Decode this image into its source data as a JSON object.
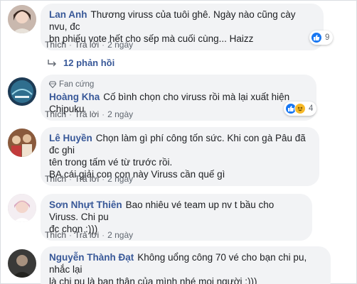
{
  "comments": [
    {
      "author": "Lan Anh",
      "lines": [
        "Thương viruss của tuôi ghê. Ngày nào cũng cày nvu, đc",
        "bn phiếu vote hết cho sếp mà cuối cùng... Haizz"
      ],
      "like_label": "Thích",
      "reply_label": "Trả lời",
      "time": "2 ngày",
      "reaction_count": "9",
      "replies_label": "12 phản hồi"
    },
    {
      "badge": "Fan cứng",
      "author": "Hoàng Kha",
      "lines": [
        "Cố bình chọn cho viruss rồi mà lại xuất hiện Chipuku"
      ],
      "like_label": "Thích",
      "reply_label": "Trả lời",
      "time": "2 ngày",
      "reaction_count": "4"
    },
    {
      "author": "Lê Huyền",
      "lines": [
        "Chọn làm gì phí công tốn sức. Khi con gà Pâu đã đc ghi",
        "tên trong tấm vé từ trước rồi.",
        "BA cái giải con con này Viruss cần quế gì"
      ],
      "like_label": "Thích",
      "reply_label": "Trả lời",
      "time": "2 ngày"
    },
    {
      "author": "Sơn Nhựt Thiên",
      "lines": [
        "Bao nhiêu vé team up nv t bầu cho Viruss. Chi pu",
        "đc chọn :)))"
      ],
      "like_label": "Thích",
      "reply_label": "Trả lời",
      "time": "2 ngày"
    },
    {
      "author": "Nguyễn Thành Đạt",
      "lines": [
        "Không uổng công 70 vé cho bạn chi pu, nhắc lại",
        "là chi pu là bạn thân của mình nhé mọi người :)))"
      ]
    }
  ],
  "colors": {
    "author": "#385898",
    "bubble": "#f2f3f5",
    "like": "#1877f2",
    "haha": "#f7b928"
  },
  "icons": [
    "like-icon",
    "haha-icon",
    "reply-arrow-icon",
    "fan-diamond-icon"
  ]
}
